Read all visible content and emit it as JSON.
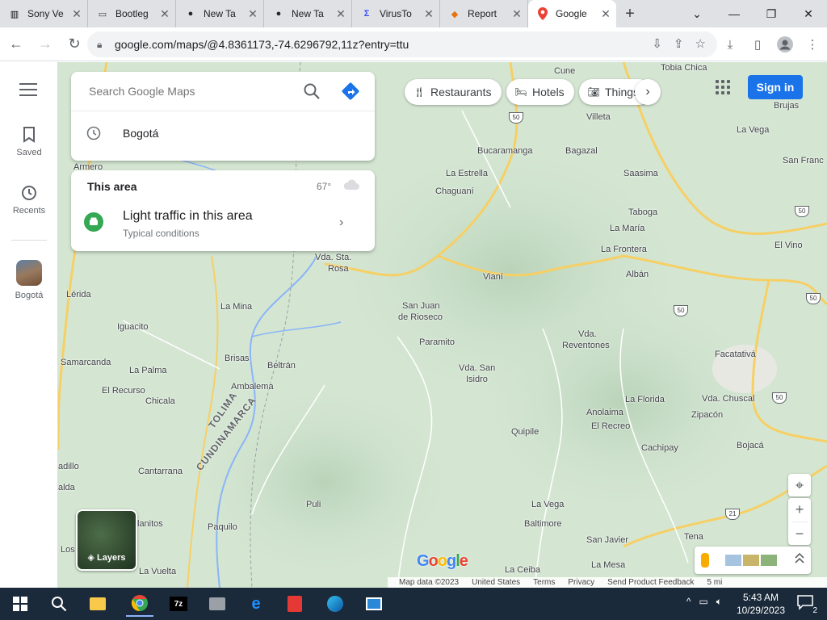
{
  "browser": {
    "tabs": [
      {
        "title": "Sony Ve",
        "icon": "sony-icon",
        "active": false
      },
      {
        "title": "Bootleg",
        "icon": "doc-icon",
        "active": false
      },
      {
        "title": "New Ta",
        "icon": "github-icon",
        "active": false
      },
      {
        "title": "New Ta",
        "icon": "github-icon",
        "active": false
      },
      {
        "title": "VirusTo",
        "icon": "virustotal-icon",
        "active": false
      },
      {
        "title": "Report",
        "icon": "report-icon",
        "active": false
      },
      {
        "title": "Google",
        "icon": "maps-pin-icon",
        "active": true
      }
    ],
    "url": "google.com/maps/@4.8361173,-74.6296792,11z?entry=ttu"
  },
  "rail": {
    "items": [
      {
        "label": "Saved",
        "icon": "bookmark-icon"
      },
      {
        "label": "Recents",
        "icon": "history-icon"
      },
      {
        "label": "Bogotá",
        "icon": "place-thumbnail"
      }
    ]
  },
  "search": {
    "placeholder": "Search Google Maps",
    "recent": "Bogotá"
  },
  "area": {
    "title": "This area",
    "temperature": "67°",
    "traffic": "Light traffic in this area",
    "traffic_sub": "Typical conditions"
  },
  "chips": [
    {
      "label": "Restaurants",
      "icon": "fork-knife-icon"
    },
    {
      "label": "Hotels",
      "icon": "bed-icon"
    },
    {
      "label": "Things",
      "icon": "camera-icon"
    }
  ],
  "signin": "Sign in",
  "layers": "Layers",
  "places": [
    {
      "name": "Cune"
    },
    {
      "name": "Tobia Chica"
    },
    {
      "name": "Brujas"
    },
    {
      "name": "Villeta"
    },
    {
      "name": "La Vega"
    },
    {
      "name": "Bucaramanga"
    },
    {
      "name": "Bagazal"
    },
    {
      "name": "San Franc"
    },
    {
      "name": "Armero"
    },
    {
      "name": "La Estrella"
    },
    {
      "name": "Saasima"
    },
    {
      "name": "Chaguaní"
    },
    {
      "name": "Taboga"
    },
    {
      "name": "La María"
    },
    {
      "name": "El Vino"
    },
    {
      "name": "La Frontera"
    },
    {
      "name": "Vda. Sta."
    },
    {
      "name": "Rosa"
    },
    {
      "name": "Vianí"
    },
    {
      "name": "Albán"
    },
    {
      "name": "Lérida"
    },
    {
      "name": "La Mina"
    },
    {
      "name": "San Juan"
    },
    {
      "name": "de Rioseco"
    },
    {
      "name": "Iguacito"
    },
    {
      "name": "Paramito"
    },
    {
      "name": "Vda."
    },
    {
      "name": "Reventones"
    },
    {
      "name": "Facatativá"
    },
    {
      "name": "Samarcanda"
    },
    {
      "name": "Brisas"
    },
    {
      "name": "Beltrán"
    },
    {
      "name": "Vda. San"
    },
    {
      "name": "Isidro"
    },
    {
      "name": "La Palma"
    },
    {
      "name": "Ambalema"
    },
    {
      "name": "El Recurso"
    },
    {
      "name": "Chicala"
    },
    {
      "name": "La Florida"
    },
    {
      "name": "Vda. Chuscal"
    },
    {
      "name": "Anolaima"
    },
    {
      "name": "Zipacón"
    },
    {
      "name": "El Recreo"
    },
    {
      "name": "Quipile"
    },
    {
      "name": "Bojacá"
    },
    {
      "name": "Cachipay"
    },
    {
      "name": "Cantarrana"
    },
    {
      "name": "adillo"
    },
    {
      "name": "alda"
    },
    {
      "name": "Puli"
    },
    {
      "name": "La Vega"
    },
    {
      "name": "lanitos"
    },
    {
      "name": "Paquilo"
    },
    {
      "name": "Baltimore"
    },
    {
      "name": "San Javier"
    },
    {
      "name": "Tena"
    },
    {
      "name": "Los"
    },
    {
      "name": "La Vuelta"
    },
    {
      "name": "La Ceiba"
    },
    {
      "name": "La Mesa"
    }
  ],
  "regions": [
    "TOLIMA",
    "CUNDINAMARCA"
  ],
  "highway_shields": [
    "50",
    "50",
    "50",
    "50",
    "50",
    "21"
  ],
  "footer": {
    "map_data": "Map data ©2023",
    "country": "United States",
    "terms": "Terms",
    "privacy": "Privacy",
    "feedback": "Send Product Feedback",
    "scale": "5 mi"
  },
  "google_logo": "Google",
  "taskbar": {
    "time": "5:43 AM",
    "date": "10/29/2023",
    "notif_count": "2",
    "apps": [
      "file-explorer-icon",
      "chrome-icon",
      "7zip-icon",
      "media-icon",
      "ie-icon",
      "acrobat-icon",
      "edge-icon",
      "app-icon"
    ]
  },
  "colors": {
    "brand_blue": "#1a73e8",
    "map_green": "#cfe2cf",
    "road_yellow": "#f6cf65",
    "river_blue": "#8ab4f8"
  }
}
